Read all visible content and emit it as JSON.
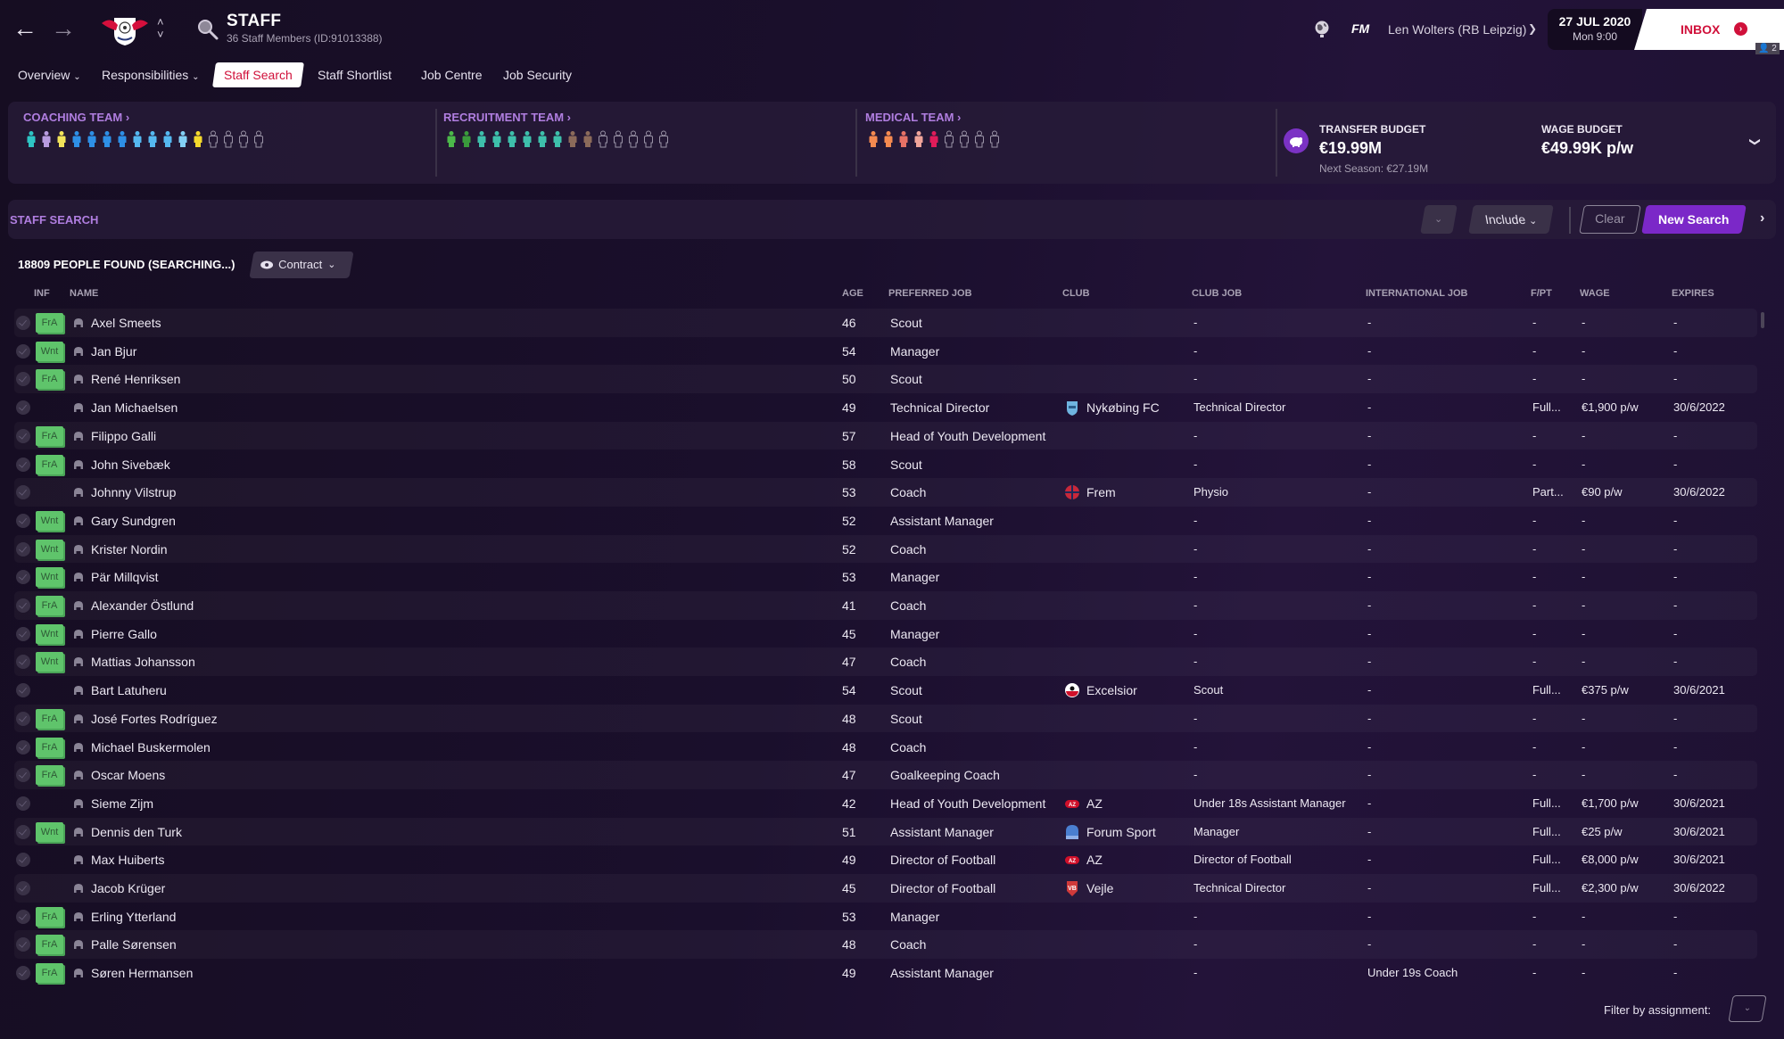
{
  "header": {
    "title": "STAFF",
    "subtitle": "36 Staff Members (ID:91013388)",
    "back_icon": "arrow-left-icon",
    "forward_icon": "arrow-right-icon",
    "fm_logo": "FM",
    "manager": "Len Wolters (RB Leipzig)",
    "date": "27 JUL 2020",
    "time": "Mon 9:00",
    "inbox_label": "INBOX",
    "inbox_icon": "chevron-right-circle-icon",
    "user_count": "2"
  },
  "tabs": [
    {
      "label": "Overview",
      "has_dropdown": true
    },
    {
      "label": "Responsibilities",
      "has_dropdown": true
    },
    {
      "label": "Staff Search",
      "active": true
    },
    {
      "label": "Staff Shortlist"
    },
    {
      "label": "Job Centre"
    },
    {
      "label": "Job Security"
    }
  ],
  "teams": {
    "coaching": {
      "title": "COACHING TEAM",
      "figures": [
        "#2ec4c4",
        "#b89be0",
        "#f2e35a",
        "#2e8fe6",
        "#2e8fe6",
        "#2e8fe6",
        "#2e8fe6",
        "#55b8f0",
        "#55b8f0",
        "#55b8f0",
        "#82cff5",
        "#f4d92c",
        "empty",
        "empty",
        "empty",
        "empty"
      ]
    },
    "recruitment": {
      "title": "RECRUITMENT TEAM",
      "figures": [
        "#4cb84a",
        "#3a9a3c",
        "#3ebfab",
        "#3ebfab",
        "#3ebfab",
        "#3ebfab",
        "#3ebfab",
        "#3ebfab",
        "#8b6a5a",
        "#8b6a5a",
        "empty",
        "empty",
        "empty",
        "empty",
        "empty"
      ]
    },
    "medical": {
      "title": "MEDICAL TEAM",
      "figures": [
        "#f48a50",
        "#f48a50",
        "#e77266",
        "#f0a49a",
        "#e01c5a",
        "empty",
        "empty",
        "empty",
        "empty"
      ]
    }
  },
  "budget": {
    "transfer_label": "TRANSFER BUDGET",
    "transfer_value": "€19.99M",
    "next_season": "Next Season: €27.19M",
    "wage_label": "WAGE BUDGET",
    "wage_value": "€49.99K p/w"
  },
  "search": {
    "title": "STAFF SEARCH",
    "include_label": "Include",
    "clear_label": "Clear",
    "new_search_label": "New Search"
  },
  "results": {
    "count_text": "18809 PEOPLE FOUND (SEARCHING...)",
    "view_label": "Contract"
  },
  "columns": {
    "inf": "INF",
    "name": "NAME",
    "age": "AGE",
    "preferred_job": "PREFERRED JOB",
    "club": "CLUB",
    "club_job": "CLUB JOB",
    "international_job": "INTERNATIONAL JOB",
    "fpt": "F/PT",
    "wage": "WAGE",
    "expires": "EXPIRES"
  },
  "rows": [
    {
      "inf": "FrA",
      "name": "Axel Smeets",
      "age": "46",
      "preferred_job": "Scout",
      "club": "",
      "club_logo": "",
      "club_job": "-",
      "intl_job": "-",
      "fpt": "-",
      "wage": "-",
      "expires": "-"
    },
    {
      "inf": "Wnt",
      "name": "Jan Bjur",
      "age": "54",
      "preferred_job": "Manager",
      "club": "",
      "club_logo": "",
      "club_job": "-",
      "intl_job": "-",
      "fpt": "-",
      "wage": "-",
      "expires": "-"
    },
    {
      "inf": "FrA",
      "name": "René Henriksen",
      "age": "50",
      "preferred_job": "Scout",
      "club": "",
      "club_logo": "",
      "club_job": "-",
      "intl_job": "-",
      "fpt": "-",
      "wage": "-",
      "expires": "-"
    },
    {
      "inf": "",
      "name": "Jan Michaelsen",
      "age": "49",
      "preferred_job": "Technical Director",
      "club": "Nykøbing FC",
      "club_logo": "nykobing",
      "club_job": "Technical Director",
      "intl_job": "-",
      "fpt": "Full...",
      "wage": "€1,900 p/w",
      "expires": "30/6/2022"
    },
    {
      "inf": "FrA",
      "name": "Filippo Galli",
      "age": "57",
      "preferred_job": "Head of Youth Development",
      "club": "",
      "club_logo": "",
      "club_job": "-",
      "intl_job": "-",
      "fpt": "-",
      "wage": "-",
      "expires": "-"
    },
    {
      "inf": "FrA",
      "name": "John Sivebæk",
      "age": "58",
      "preferred_job": "Scout",
      "club": "",
      "club_logo": "",
      "club_job": "-",
      "intl_job": "-",
      "fpt": "-",
      "wage": "-",
      "expires": "-"
    },
    {
      "inf": "",
      "name": "Johnny Vilstrup",
      "age": "53",
      "preferred_job": "Coach",
      "club": "Frem",
      "club_logo": "frem",
      "club_job": "Physio",
      "intl_job": "-",
      "fpt": "Part...",
      "wage": "€90 p/w",
      "expires": "30/6/2022"
    },
    {
      "inf": "Wnt",
      "name": "Gary Sundgren",
      "age": "52",
      "preferred_job": "Assistant Manager",
      "club": "",
      "club_logo": "",
      "club_job": "-",
      "intl_job": "-",
      "fpt": "-",
      "wage": "-",
      "expires": "-"
    },
    {
      "inf": "Wnt",
      "name": "Krister Nordin",
      "age": "52",
      "preferred_job": "Coach",
      "club": "",
      "club_logo": "",
      "club_job": "-",
      "intl_job": "-",
      "fpt": "-",
      "wage": "-",
      "expires": "-"
    },
    {
      "inf": "Wnt",
      "name": "Pär Millqvist",
      "age": "53",
      "preferred_job": "Manager",
      "club": "",
      "club_logo": "",
      "club_job": "-",
      "intl_job": "-",
      "fpt": "-",
      "wage": "-",
      "expires": "-"
    },
    {
      "inf": "FrA",
      "name": "Alexander Östlund",
      "age": "41",
      "preferred_job": "Coach",
      "club": "",
      "club_logo": "",
      "club_job": "-",
      "intl_job": "-",
      "fpt": "-",
      "wage": "-",
      "expires": "-"
    },
    {
      "inf": "Wnt",
      "name": "Pierre Gallo",
      "age": "45",
      "preferred_job": "Manager",
      "club": "",
      "club_logo": "",
      "club_job": "-",
      "intl_job": "-",
      "fpt": "-",
      "wage": "-",
      "expires": "-"
    },
    {
      "inf": "Wnt",
      "name": "Mattias Johansson",
      "age": "47",
      "preferred_job": "Coach",
      "club": "",
      "club_logo": "",
      "club_job": "-",
      "intl_job": "-",
      "fpt": "-",
      "wage": "-",
      "expires": "-"
    },
    {
      "inf": "",
      "name": "Bart Latuheru",
      "age": "54",
      "preferred_job": "Scout",
      "club": "Excelsior",
      "club_logo": "excelsior",
      "club_job": "Scout",
      "intl_job": "-",
      "fpt": "Full...",
      "wage": "€375 p/w",
      "expires": "30/6/2021"
    },
    {
      "inf": "FrA",
      "name": "José Fortes Rodríguez",
      "age": "48",
      "preferred_job": "Scout",
      "club": "",
      "club_logo": "",
      "club_job": "-",
      "intl_job": "-",
      "fpt": "-",
      "wage": "-",
      "expires": "-"
    },
    {
      "inf": "FrA",
      "name": "Michael Buskermolen",
      "age": "48",
      "preferred_job": "Coach",
      "club": "",
      "club_logo": "",
      "club_job": "-",
      "intl_job": "-",
      "fpt": "-",
      "wage": "-",
      "expires": "-"
    },
    {
      "inf": "FrA",
      "name": "Oscar Moens",
      "age": "47",
      "preferred_job": "Goalkeeping Coach",
      "club": "",
      "club_logo": "",
      "club_job": "-",
      "intl_job": "-",
      "fpt": "-",
      "wage": "-",
      "expires": "-"
    },
    {
      "inf": "",
      "name": "Sieme Zijm",
      "age": "42",
      "preferred_job": "Head of Youth Development",
      "club": "AZ",
      "club_logo": "az",
      "club_job": "Under 18s Assistant Manager",
      "intl_job": "-",
      "fpt": "Full...",
      "wage": "€1,700 p/w",
      "expires": "30/6/2021"
    },
    {
      "inf": "Wnt",
      "name": "Dennis den Turk",
      "age": "51",
      "preferred_job": "Assistant Manager",
      "club": "Forum Sport",
      "club_logo": "forum",
      "club_job": "Manager",
      "intl_job": "-",
      "fpt": "Full...",
      "wage": "€25 p/w",
      "expires": "30/6/2021"
    },
    {
      "inf": "",
      "name": "Max Huiberts",
      "age": "49",
      "preferred_job": "Director of Football",
      "club": "AZ",
      "club_logo": "az",
      "club_job": "Director of Football",
      "intl_job": "-",
      "fpt": "Full...",
      "wage": "€8,000 p/w",
      "expires": "30/6/2021"
    },
    {
      "inf": "",
      "name": "Jacob Krüger",
      "age": "45",
      "preferred_job": "Director of Football",
      "club": "Vejle",
      "club_logo": "vejle",
      "club_job": "Technical Director",
      "intl_job": "-",
      "fpt": "Full...",
      "wage": "€2,300 p/w",
      "expires": "30/6/2022"
    },
    {
      "inf": "FrA",
      "name": "Erling Ytterland",
      "age": "53",
      "preferred_job": "Manager",
      "club": "",
      "club_logo": "",
      "club_job": "-",
      "intl_job": "-",
      "fpt": "-",
      "wage": "-",
      "expires": "-"
    },
    {
      "inf": "FrA",
      "name": "Palle Sørensen",
      "age": "48",
      "preferred_job": "Coach",
      "club": "",
      "club_logo": "",
      "club_job": "-",
      "intl_job": "-",
      "fpt": "-",
      "wage": "-",
      "expires": "-"
    },
    {
      "inf": "FrA",
      "name": "Søren Hermansen",
      "age": "49",
      "preferred_job": "Assistant Manager",
      "club": "",
      "club_logo": "",
      "club_job": "-",
      "intl_job": "Under 19s Coach",
      "fpt": "-",
      "wage": "-",
      "expires": "-"
    }
  ],
  "footer": {
    "filter_label": "Filter by assignment:"
  },
  "colors": {
    "accent_purple": "#7b28c8",
    "section_title": "#b07ee0",
    "inbox_red": "#d0103a",
    "inf_green": "#5fc46b"
  }
}
